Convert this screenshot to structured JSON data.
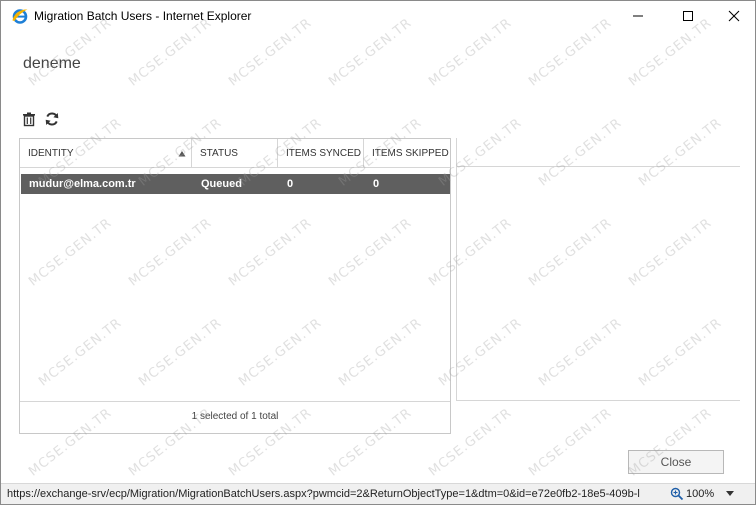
{
  "window": {
    "title": "Migration Batch Users - Internet Explorer"
  },
  "page": {
    "title": "deneme"
  },
  "toolbar": {
    "delete_icon": "trash-icon",
    "refresh_icon": "refresh-icon"
  },
  "table": {
    "columns": [
      "IDENTITY",
      "STATUS",
      "ITEMS SYNCED",
      "ITEMS SKIPPED"
    ],
    "sort": {
      "column": "IDENTITY",
      "direction": "ascending"
    },
    "rows": [
      {
        "identity": "mudur@elma.com.tr",
        "status": "Queued",
        "items_synced": "0",
        "items_skipped": "0",
        "selected": true
      }
    ],
    "footer": "1 selected of 1 total"
  },
  "actions": {
    "close_label": "Close"
  },
  "statusbar": {
    "url": "https://exchange-srv/ecp/Migration/MigrationBatchUsers.aspx?pwmcid=2&ReturnObjectType=1&dtm=0&id=e72e0fb2-18e5-409b-l",
    "zoom": "100%"
  },
  "watermark": {
    "text": "MCSE.GEN.TR"
  },
  "colors": {
    "selected_row": "#5f5f5f",
    "ie_blue": "#1e7fd6"
  }
}
